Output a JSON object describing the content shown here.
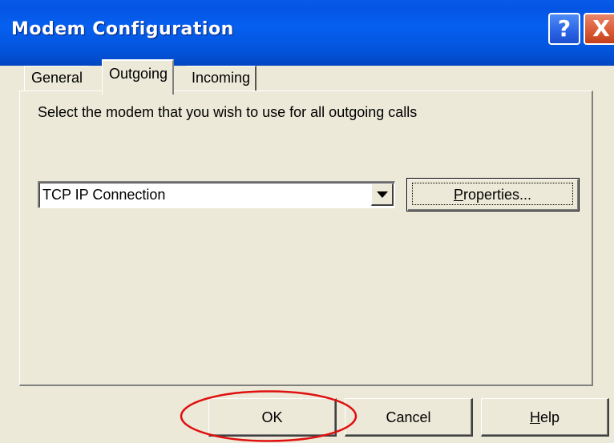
{
  "window": {
    "title": "Modem Configuration",
    "help_glyph": "?",
    "close_glyph": "X"
  },
  "tabs": [
    {
      "label": "General",
      "active": false
    },
    {
      "label": "Outgoing",
      "active": true
    },
    {
      "label": "Incoming",
      "active": false
    }
  ],
  "outgoing": {
    "instruction": "Select the modem that you wish to use for all outgoing calls",
    "modem_select": {
      "value": "TCP IP Connection"
    },
    "properties_button": {
      "mnemonic": "P",
      "rest": "roperties..."
    }
  },
  "footer": {
    "ok_label": "OK",
    "cancel_label": "Cancel",
    "help_button": {
      "mnemonic": "H",
      "rest": "elp"
    }
  },
  "colors": {
    "titlebar": "#0554e3",
    "dialog_bg": "#ece9d8",
    "close_button": "#d95a33",
    "annotation": "#e01010"
  },
  "icons": {
    "help": "help-icon",
    "close": "close-icon",
    "dropdown": "chevron-down-icon"
  }
}
